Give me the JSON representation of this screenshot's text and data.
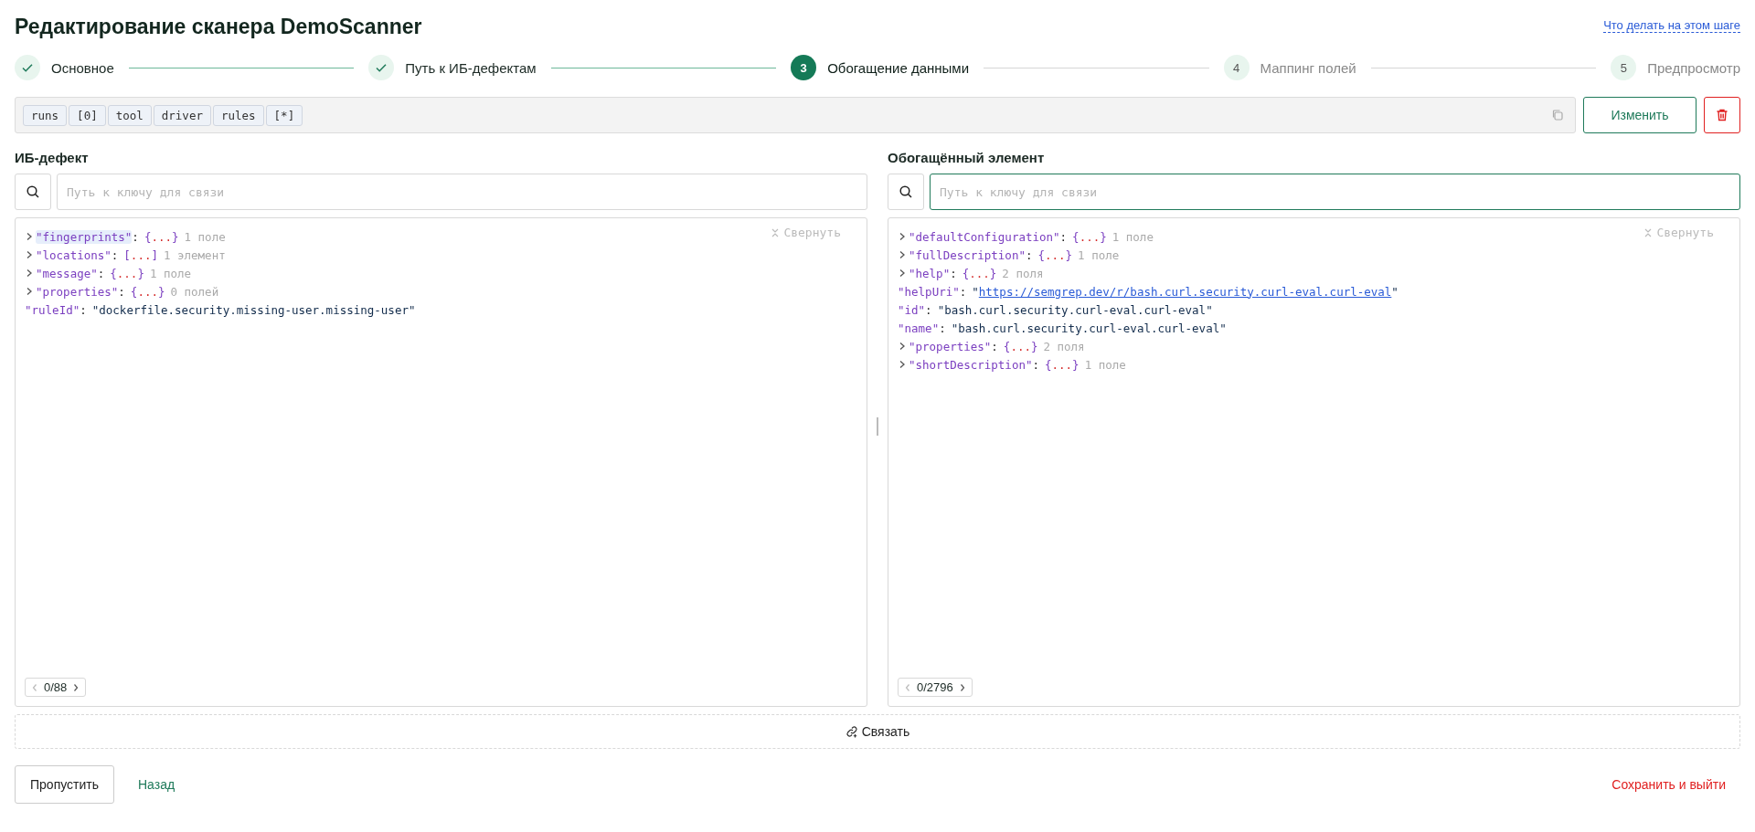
{
  "title": "Редактирование сканера DemoScanner",
  "help_link": "Что делать на этом шаге",
  "steps": [
    {
      "label": "Основное",
      "done": true,
      "active": false
    },
    {
      "label": "Путь к ИБ-дефектам",
      "done": true,
      "active": false
    },
    {
      "number": "3",
      "label": "Обогащение данными",
      "done": false,
      "active": true
    },
    {
      "number": "4",
      "label": "Маппинг полей",
      "done": false,
      "active": false
    },
    {
      "number": "5",
      "label": "Предпросмотр",
      "done": false,
      "active": false
    }
  ],
  "path": [
    "runs",
    "[0]",
    "tool",
    "driver",
    "rules",
    "[*]"
  ],
  "edit_button": "Изменить",
  "panels": [
    {
      "title": "ИБ-дефект",
      "search": {
        "placeholder": "Путь к ключу для связи",
        "focused": false
      },
      "collapse": "Свернуть",
      "pager": "0/88",
      "rows": [
        {
          "kind": "node",
          "key": "\"fingerprints\"",
          "colon": ":",
          "open": "{",
          "dots": "...",
          "close": "}",
          "summary": "1 поле",
          "highlighted": true
        },
        {
          "kind": "node",
          "key": "\"locations\"",
          "colon": ":",
          "open": "[",
          "dots": "...",
          "close": "]",
          "summary": "1 элемент",
          "highlighted": false
        },
        {
          "kind": "node",
          "key": "\"message\"",
          "colon": ":",
          "open": "{",
          "dots": "...",
          "close": "}",
          "summary": "1 поле",
          "highlighted": false
        },
        {
          "kind": "node",
          "key": "\"properties\"",
          "colon": ":",
          "open": "{",
          "dots": "...",
          "close": "}",
          "summary": "0 полей",
          "highlighted": false
        },
        {
          "kind": "value",
          "key": "\"ruleId\"",
          "colon": ":",
          "value": "\"dockerfile.security.missing-user.missing-user\"",
          "highlighted": false
        }
      ]
    },
    {
      "title": "Обогащённый элемент",
      "search": {
        "placeholder": "Путь к ключу для связи",
        "focused": true
      },
      "collapse": "Свернуть",
      "pager": "0/2796",
      "rows": [
        {
          "kind": "node",
          "key": "\"defaultConfiguration\"",
          "colon": ":",
          "open": "{",
          "dots": "...",
          "close": "}",
          "summary": "1 поле",
          "highlighted": false
        },
        {
          "kind": "node",
          "key": "\"fullDescription\"",
          "colon": ":",
          "open": "{",
          "dots": "...",
          "close": "}",
          "summary": "1 поле",
          "highlighted": false
        },
        {
          "kind": "node",
          "key": "\"help\"",
          "colon": ":",
          "open": "{",
          "dots": "...",
          "close": "}",
          "summary": "2 поля",
          "highlighted": false
        },
        {
          "kind": "link",
          "key": "\"helpUri\"",
          "colon": ":",
          "quote": "\"",
          "value": "https://semgrep.dev/r/bash.curl.security.curl-eval.curl-eval",
          "highlighted": false
        },
        {
          "kind": "value",
          "key": "\"id\"",
          "colon": ":",
          "value": "\"bash.curl.security.curl-eval.curl-eval\"",
          "highlighted": false
        },
        {
          "kind": "value",
          "key": "\"name\"",
          "colon": ":",
          "value": "\"bash.curl.security.curl-eval.curl-eval\"",
          "highlighted": false
        },
        {
          "kind": "node",
          "key": "\"properties\"",
          "colon": ":",
          "open": "{",
          "dots": "...",
          "close": "}",
          "summary": "2 поля",
          "highlighted": false
        },
        {
          "kind": "node",
          "key": "\"shortDescription\"",
          "colon": ":",
          "open": "{",
          "dots": "...",
          "close": "}",
          "summary": "1 поле",
          "highlighted": false
        }
      ]
    }
  ],
  "link_button": "Связать",
  "footer": {
    "skip": "Пропустить",
    "back": "Назад",
    "save": "Сохранить и выйти"
  }
}
